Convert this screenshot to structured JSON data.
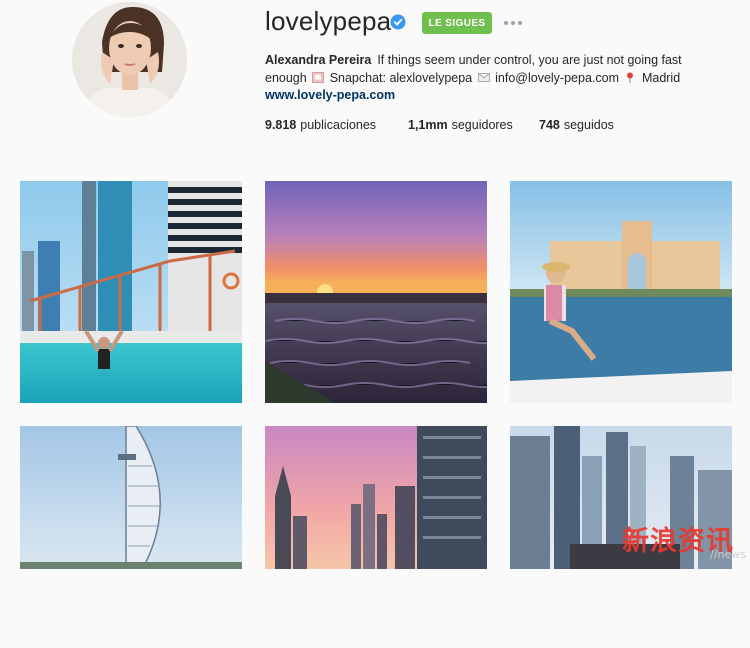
{
  "profile": {
    "username": "lovelypepa",
    "follow_label": "LE SIGUES",
    "full_name": "Alexandra Pereira",
    "bio_part1": "If things seem under control, you are just not going fast enough",
    "bio_part2": "Snapchat: alexlovelypepa",
    "bio_part3": "info@lovely-pepa.com",
    "bio_part4": "Madrid",
    "website": "www.lovely-pepa.com",
    "icons": {
      "verified": "verified-badge-icon",
      "more": "more-options-icon",
      "snapchat": "ghost-emoji-icon",
      "email": "envelope-emoji-icon",
      "location": "pin-emoji-icon"
    },
    "colors": {
      "follow_button": "#70c050",
      "verified": "#3897f0",
      "link": "#003569"
    }
  },
  "stats": {
    "posts_count": "9.818",
    "posts_label": "publicaciones",
    "followers_count": "1,1mm",
    "followers_label": "seguidores",
    "following_count": "748",
    "following_label": "seguidos"
  },
  "posts": [
    "pool-skyscrapers-photo",
    "sunset-water-photo",
    "boat-atlantis-photo",
    "burj-al-arab-photo",
    "pink-sky-towers-photo",
    "marina-towers-photo"
  ],
  "watermark": {
    "main": "新浪资讯",
    "sub": "//news"
  }
}
